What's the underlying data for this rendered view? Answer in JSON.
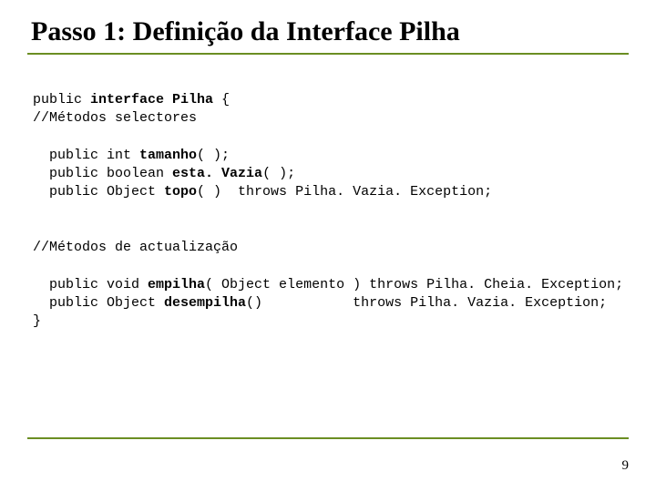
{
  "title": "Passo 1: Definição da Interface Pilha",
  "code": {
    "l1a": "public ",
    "l1b": "interface Pilha ",
    "l1c": "{",
    "l2": "//Métodos selectores",
    "l3a": "  public int ",
    "l3b": "tamanho",
    "l3c": "( );",
    "l4a": "  public boolean ",
    "l4b": "esta. Vazia",
    "l4c": "( );",
    "l5a": "  public Object ",
    "l5b": "topo",
    "l5c": "( )  throws Pilha. Vazia. Exception;",
    "l6": "//Métodos de actualização",
    "l7a": "  public void ",
    "l7b": "empilha",
    "l7c": "( Object elemento ) throws Pilha. Cheia. Exception;",
    "l8a": "  public Object ",
    "l8b": "desempilha",
    "l8c": "()           throws Pilha. Vazia. Exception;",
    "l9": "}"
  },
  "page_number": "9"
}
